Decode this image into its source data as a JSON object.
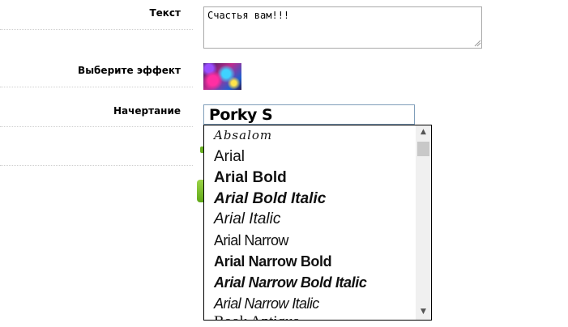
{
  "form": {
    "text_label": "Текст",
    "text_value": "Счастья вам!!!",
    "effect_label": "Выберите эффект",
    "style_label": "Начертание",
    "selected_font": "Porky S"
  },
  "font_list": {
    "items": [
      "Absalom",
      "Arial",
      "Arial Bold",
      "Arial Bold Italic",
      "Arial Italic",
      "Arial Narrow",
      "Arial Narrow Bold",
      "Arial Narrow Bold Italic",
      "Arial Narrow Italic",
      "Book Antiqua"
    ]
  },
  "icons": {
    "scroll_up": "arrow-up-icon",
    "scroll_down": "arrow-down-icon"
  }
}
